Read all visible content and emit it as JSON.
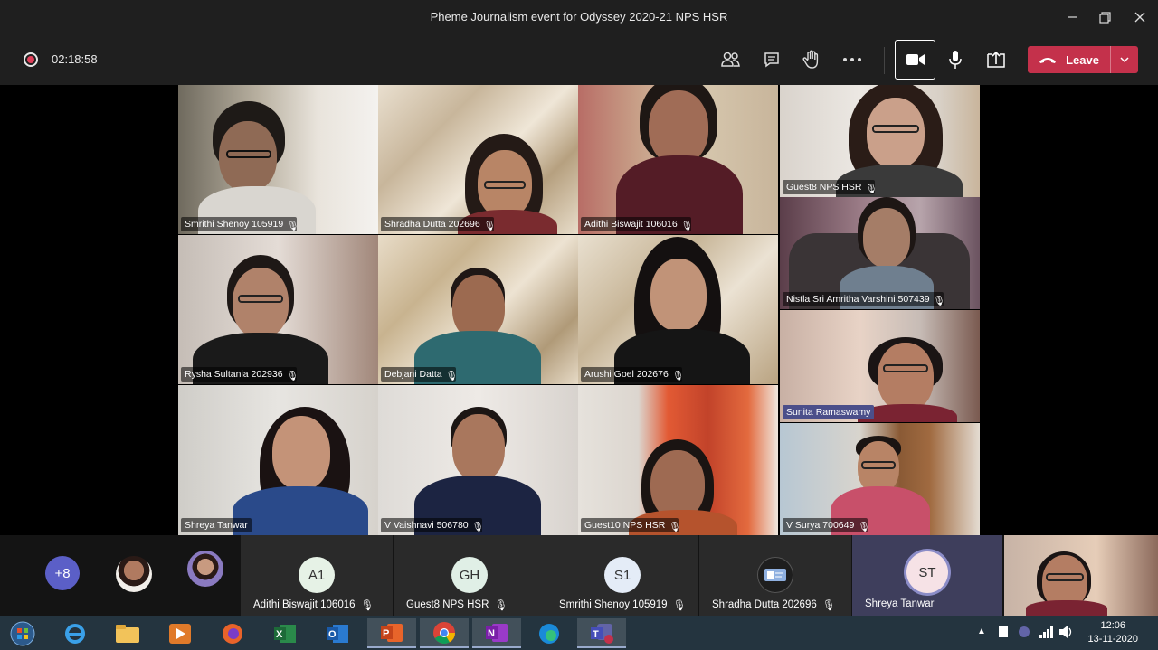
{
  "window": {
    "title": "Pheme Journalism event for Odyssey 2020-21 NPS HSR"
  },
  "toolbar": {
    "timer": "02:18:58",
    "leave_label": "Leave",
    "icons": [
      "participants-icon",
      "chat-icon",
      "raise-hand-icon",
      "more-icon",
      "camera-icon",
      "mic-icon",
      "share-icon",
      "hangup-icon"
    ]
  },
  "tiles": [
    {
      "name": "Smrithi Shenoy 105919"
    },
    {
      "name": "Shradha Dutta 202696"
    },
    {
      "name": "Adithi Biswajit 106016"
    },
    {
      "name": "Guest8 NPS HSR"
    },
    {
      "name": "Nistla Sri Amritha Varshini 507439"
    },
    {
      "name": "Rysha Sultania 202936"
    },
    {
      "name": "Debjani Datta"
    },
    {
      "name": "Arushi Goel 202676"
    },
    {
      "name": "Sunita Ramaswamy"
    },
    {
      "name": "Shreya Tanwar"
    },
    {
      "name": "V Vaishnavi 506780"
    },
    {
      "name": "Guest10 NPS HSR"
    },
    {
      "name": "V Surya 700649"
    }
  ],
  "strip": {
    "overflow": "+8",
    "participants": [
      {
        "initials": "A1",
        "name": "Adithi Biswajit 106016"
      },
      {
        "initials": "GH",
        "name": "Guest8 NPS HSR"
      },
      {
        "initials": "S1",
        "name": "Smrithi Shenoy 105919"
      },
      {
        "initials": "",
        "name": "Shradha Dutta 202696"
      },
      {
        "initials": "ST",
        "name": "Shreya Tanwar"
      }
    ]
  },
  "taskbar": {
    "time": "12:06",
    "date": "13-11-2020"
  }
}
